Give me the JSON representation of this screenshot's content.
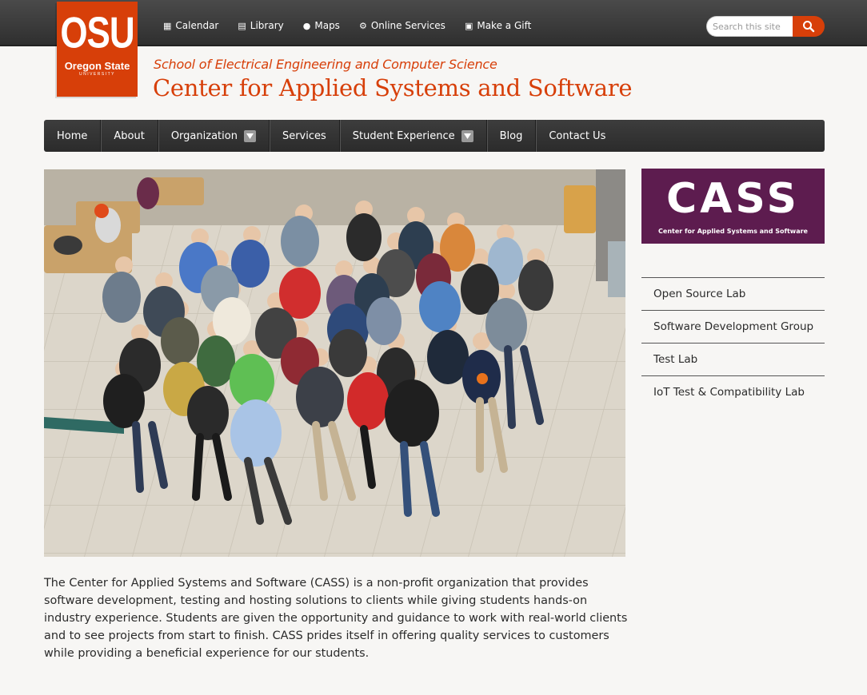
{
  "topbar": {
    "links": [
      {
        "label": "Calendar",
        "icon": "calendar-icon"
      },
      {
        "label": "Library",
        "icon": "book-icon"
      },
      {
        "label": "Maps",
        "icon": "map-marker-icon"
      },
      {
        "label": "Online Services",
        "icon": "gears-icon"
      },
      {
        "label": "Make a Gift",
        "icon": "gift-icon"
      }
    ],
    "search_placeholder": "Search this site"
  },
  "logo": {
    "line1": "OSU",
    "line2": "Oregon State",
    "line3": "UNIVERSITY"
  },
  "header": {
    "school": "School of Electrical Engineering and Computer Science",
    "title": "Center for Applied Systems and Software"
  },
  "nav": {
    "items": [
      {
        "label": "Home"
      },
      {
        "label": "About"
      },
      {
        "label": "Organization"
      },
      {
        "label": "Services"
      },
      {
        "label": "Student Experience"
      },
      {
        "label": "Blog"
      },
      {
        "label": "Contact Us"
      }
    ]
  },
  "main": {
    "description": "The Center for Applied Systems and Software (CASS) is a non-profit organization that provides software development, testing and hosting solutions to clients while giving students hands-on industry experience. Students are given the opportunity and guidance to work with real-world clients and to see projects from start to finish. CASS prides itself in offering quality services to customers while providing a beneficial experience for our students."
  },
  "sidebar": {
    "cass_logo_big": "CASS",
    "cass_logo_small": "Center for Applied Systems and Software",
    "items": [
      {
        "label": "Open Source Lab"
      },
      {
        "label": "Software Development Group"
      },
      {
        "label": "Test Lab"
      },
      {
        "label": "IoT Test & Compatibility Lab"
      }
    ]
  },
  "colors": {
    "brand_orange": "#d73f09",
    "nav_dark": "#333333",
    "cass_purple": "#5d1c4f"
  }
}
